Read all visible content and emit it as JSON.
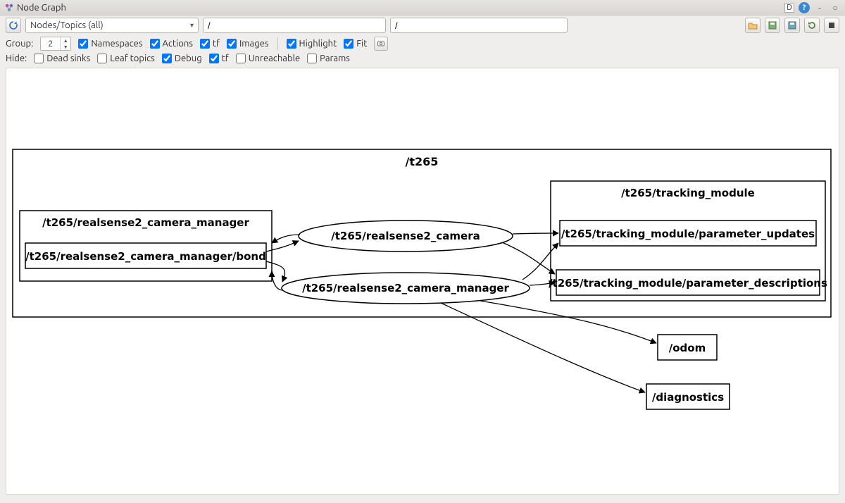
{
  "window": {
    "title": "Node Graph"
  },
  "toolbar": {
    "dropdown_value": "Nodes/Topics (all)",
    "filter1_value": "/",
    "filter2_value": "/",
    "right_icons": [
      "open-icon",
      "save-icon",
      "save-as-icon",
      "refresh-icon",
      "stop-icon"
    ]
  },
  "controls": {
    "group_label": "Group:",
    "group_value": "2",
    "checkboxes_row1": [
      {
        "key": "namespaces",
        "label": "Namespaces",
        "checked": true
      },
      {
        "key": "actions",
        "label": "Actions",
        "checked": true
      },
      {
        "key": "tf",
        "label": "tf",
        "checked": true
      },
      {
        "key": "images",
        "label": "Images",
        "checked": true
      }
    ],
    "checkboxes_row1b": [
      {
        "key": "highlight",
        "label": "Highlight",
        "checked": true
      },
      {
        "key": "fit",
        "label": "Fit",
        "checked": true
      }
    ],
    "hide_label": "Hide:",
    "checkboxes_row2": [
      {
        "key": "dead_sinks",
        "label": "Dead sinks",
        "checked": false
      },
      {
        "key": "leaf_topics",
        "label": "Leaf topics",
        "checked": false
      },
      {
        "key": "debug",
        "label": "Debug",
        "checked": true
      },
      {
        "key": "tf2",
        "label": "tf",
        "checked": true
      },
      {
        "key": "unreachable",
        "label": "Unreachable",
        "checked": false
      },
      {
        "key": "params",
        "label": "Params",
        "checked": false
      }
    ]
  },
  "graph": {
    "outer_group": "/t265",
    "left_group": {
      "title": "/t265/realsense2_camera_manager",
      "child": "/t265/realsense2_camera_manager/bond"
    },
    "right_group": {
      "title": "/t265/tracking_module",
      "children": [
        "/t265/tracking_module/parameter_updates",
        "/t265/tracking_module/parameter_descriptions"
      ]
    },
    "ellipse_nodes": [
      "/t265/realsense2_camera",
      "/t265/realsense2_camera_manager"
    ],
    "free_nodes": [
      "/odom",
      "/diagnostics"
    ]
  },
  "wm": {
    "d_label": "D"
  }
}
